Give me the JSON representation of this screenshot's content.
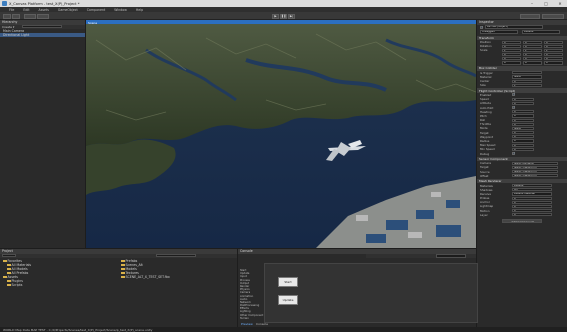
{
  "window": {
    "title": "X_Canvas Platform - test_X(P)_Project *",
    "min": "–",
    "max": "□",
    "close": "✕"
  },
  "menu": [
    "File",
    "Edit",
    "Assets",
    "GameObject",
    "Component",
    "Window",
    "Help"
  ],
  "toolbar": {
    "b1": "",
    "b2": "",
    "b3": "",
    "b4": "",
    "play": "▶",
    "pause": "❚❚",
    "step": "▶|",
    "layers": "",
    "layout": ""
  },
  "hierarchy": {
    "title": "Hierarchy",
    "create": "Create ▾",
    "search_placeholder": "",
    "items": [
      "Main Camera",
      "Directional Light",
      "Terrain",
      "Aircraft"
    ]
  },
  "viewport": {
    "tab": "Scene"
  },
  "inspector": {
    "title": "Inspector",
    "object_name": "Aircraft (Object)",
    "tag": "Untagged",
    "layer": "Default",
    "sections": {
      "transform": {
        "title": "Transform",
        "rows": [
          {
            "label": "Position",
            "x": "0",
            "y": "0",
            "z": "0"
          },
          {
            "label": "Rotation",
            "x": "0",
            "y": "0",
            "z": "0"
          },
          {
            "label": "Scale",
            "x": "1",
            "y": "1",
            "z": "1"
          },
          {
            "label": "",
            "x": "0",
            "y": "0",
            "z": "0"
          },
          {
            "label": "",
            "x": "0",
            "y": "0",
            "z": "0"
          },
          {
            "label": "",
            "x": "0",
            "y": "0",
            "z": "0"
          }
        ]
      },
      "collider": {
        "title": "Box Collider",
        "rows": [
          {
            "label": "Is Trigger",
            "value": ""
          },
          {
            "label": "Material",
            "value": "None"
          },
          {
            "label": "Center",
            "value": "0"
          },
          {
            "label": "Size",
            "value": "1"
          }
        ]
      },
      "flight": {
        "title": "Flight Controller (Script)",
        "rows": [
          {
            "label": "Enabled",
            "value": "✓"
          },
          {
            "label": "Speed",
            "value": "0"
          },
          {
            "label": "Altitude",
            "value": "0"
          },
          {
            "label": "Auto Pilot",
            "value": "✓"
          },
          {
            "label": "Heading",
            "value": "0"
          },
          {
            "label": "Pitch",
            "value": "0"
          },
          {
            "label": "Roll",
            "value": "0"
          },
          {
            "label": "Throttle",
            "value": "0"
          },
          {
            "label": "Mode",
            "value": "None"
          },
          {
            "label": "Target",
            "value": "0"
          },
          {
            "label": "Waypoint",
            "value": "0"
          },
          {
            "label": "Radius",
            "value": "0"
          },
          {
            "label": "Max Speed",
            "value": "0"
          },
          {
            "label": "Min Speed",
            "value": "0"
          },
          {
            "label": "Debug",
            "value": "✓"
          }
        ]
      },
      "sensor": {
        "title": "Sensor Component",
        "rows": [
          {
            "label": "Camera",
            "value": "None (Camera)"
          },
          {
            "label": "Target",
            "value": "None (Transform)"
          },
          {
            "label": "Source",
            "value": "None (Transform)"
          },
          {
            "label": "Offset",
            "value": "None (Transform)"
          }
        ]
      },
      "renderer": {
        "title": "Mesh Renderer",
        "rows": [
          {
            "label": "Materials",
            "value": "Default"
          },
          {
            "label": "Shadows",
            "value": "On"
          },
          {
            "label": "Receive",
            "value": "Default Material"
          },
          {
            "label": "Probes",
            "value": "0"
          },
          {
            "label": "Anchor",
            "value": "0"
          },
          {
            "label": "Lightmap",
            "value": "0"
          },
          {
            "label": "Motion",
            "value": "0"
          },
          {
            "label": "Layer",
            "value": "0"
          }
        ]
      }
    },
    "add_component": "Add Component"
  },
  "project": {
    "title": "Project",
    "tree": [
      "Favorites",
      "All Materials",
      "All Models",
      "All Prefabs",
      "Assets",
      "Plugins",
      "Scripts"
    ],
    "files": [
      "Prefabs",
      "Scenes_Alt",
      "Models",
      "Textures",
      "SCENE_ALT_X_TEST_SET.fbx"
    ]
  },
  "preview": {
    "title": "Console",
    "tree_items": [
      "Start",
      "Update",
      "Input",
      "Process",
      "Output",
      "Render",
      "Physics",
      "Camera",
      "Animation",
      "Audio",
      "Network",
      "PostProcessing",
      "Effects",
      "Lighting",
      "Other Component",
      "Terrain"
    ],
    "start_button": "Start",
    "update_button": "Update",
    "tab1": "Preview",
    "tab2": "Console"
  },
  "status": "WORLD Map Data MAP TEST - C:/X/Projects/Scenes/test_X(P)_Project/Scene/p_test_X(P)_scene.unity"
}
